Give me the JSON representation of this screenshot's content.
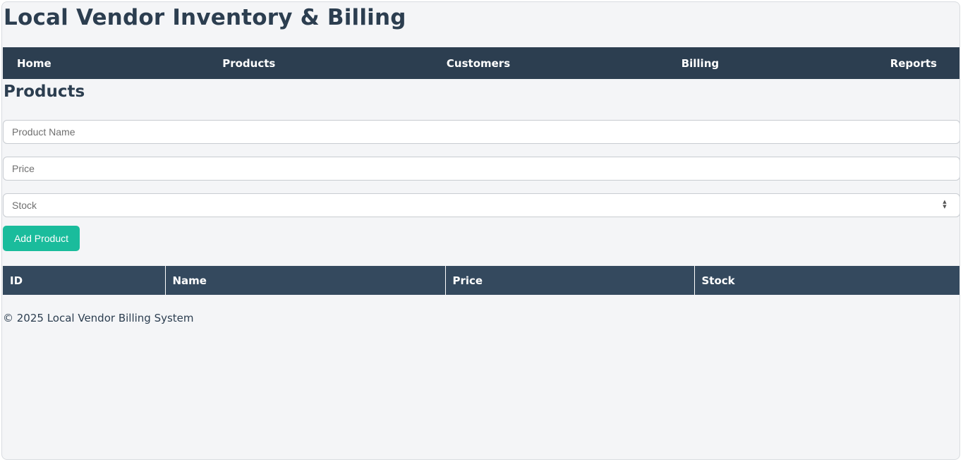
{
  "header": {
    "title": "Local Vendor Inventory & Billing"
  },
  "nav": {
    "items": [
      {
        "label": "Home"
      },
      {
        "label": "Products"
      },
      {
        "label": "Customers"
      },
      {
        "label": "Billing"
      },
      {
        "label": "Reports"
      }
    ]
  },
  "main": {
    "section_title": "Products",
    "form": {
      "product_name": {
        "placeholder": "Product Name",
        "value": ""
      },
      "price": {
        "placeholder": "Price",
        "value": ""
      },
      "stock": {
        "placeholder": "Stock",
        "value": ""
      },
      "stepper_icon": "spin-arrows-icon",
      "add_button_label": "Add Product"
    },
    "table": {
      "columns": [
        "ID",
        "Name",
        "Price",
        "Stock"
      ],
      "rows": []
    }
  },
  "footer": {
    "text": "© 2025 Local Vendor Billing System"
  },
  "colors": {
    "primary": "#2c3e50",
    "table_header": "#34495e",
    "accent": "#1abc9c",
    "background": "#f4f5f7"
  }
}
